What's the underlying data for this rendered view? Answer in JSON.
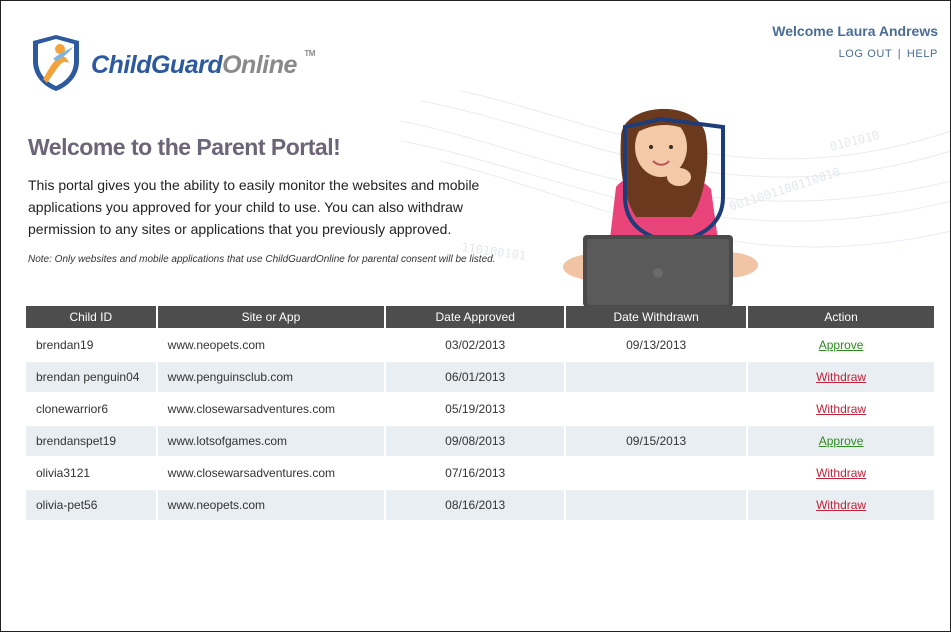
{
  "brand": {
    "name_part1": "ChildGuard",
    "name_part2": "Online",
    "tm": "TM",
    "colors": {
      "blue": "#2d5a9e",
      "gray": "#8a8a8a",
      "orange": "#f2a33a"
    }
  },
  "header": {
    "welcome": "Welcome Laura Andrews",
    "logout": "LOG OUT",
    "separator": "|",
    "help": "HELP"
  },
  "hero": {
    "title": "Welcome to the Parent Portal!",
    "description": "This portal gives you the ability to easily monitor the websites and mobile applications you approved for your child to use. You can also withdraw permission to any sites or applications that you previously approved.",
    "note": "Note: Only websites and mobile applications that use ChildGuardOnline for parental consent will be listed."
  },
  "table": {
    "headers": [
      "Child ID",
      "Site or App",
      "Date Approved",
      "Date Withdrawn",
      "Action"
    ],
    "rows": [
      {
        "child_id": "brendan19",
        "site": "www.neopets.com",
        "date_approved": "03/02/2013",
        "date_withdrawn": "09/13/2013",
        "action": "Approve"
      },
      {
        "child_id": "brendan penguin04",
        "site": "www.penguinsclub.com",
        "date_approved": "06/01/2013",
        "date_withdrawn": "",
        "action": "Withdraw"
      },
      {
        "child_id": "clonewarrior6",
        "site": "www.closewarsadventures.com",
        "date_approved": "05/19/2013",
        "date_withdrawn": "",
        "action": "Withdraw"
      },
      {
        "child_id": "brendanspet19",
        "site": "www.lotsofgames.com",
        "date_approved": "09/08/2013",
        "date_withdrawn": "09/15/2013",
        "action": "Approve"
      },
      {
        "child_id": "olivia3121",
        "site": "www.closewarsadventures.com",
        "date_approved": "07/16/2013",
        "date_withdrawn": "",
        "action": "Withdraw"
      },
      {
        "child_id": "olivia-pet56",
        "site": "www.neopets.com",
        "date_approved": "08/16/2013",
        "date_withdrawn": "",
        "action": "Withdraw"
      }
    ],
    "colors": {
      "header_bg": "#4d4d4d",
      "alt_row": "#e9eef3",
      "approve": "#2e8b1e",
      "withdraw": "#c0243a"
    }
  }
}
